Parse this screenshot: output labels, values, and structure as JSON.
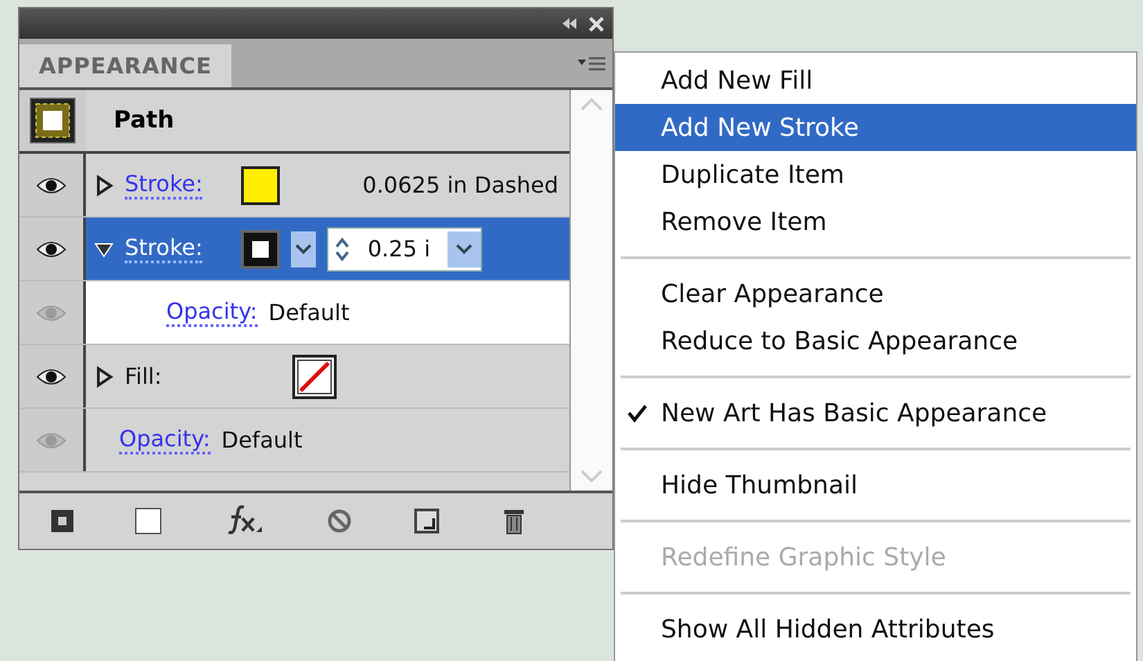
{
  "panel": {
    "tab": "APPEARANCE",
    "object": "Path",
    "rows": [
      {
        "kind": "stroke",
        "label": "Stroke:",
        "link": true,
        "expanded": false,
        "selected": false,
        "eye_dimmed": false,
        "color": "#ffee00",
        "value": "0.0625 in Dashed"
      },
      {
        "kind": "stroke",
        "label": "Stroke:",
        "link": true,
        "expanded": true,
        "selected": true,
        "eye_dimmed": false,
        "weight": "0.25 i",
        "children": [
          {
            "kind": "opacity",
            "label": "Opacity:",
            "link": true,
            "selected": false,
            "eye_dimmed": true,
            "value": "Default"
          }
        ]
      },
      {
        "kind": "fill",
        "label": "Fill:",
        "link": false,
        "expanded": false,
        "selected": false,
        "eye_dimmed": false
      },
      {
        "kind": "opacity",
        "label": "Opacity:",
        "link": true,
        "selected": false,
        "eye_dimmed": true,
        "value": "Default"
      }
    ]
  },
  "menu": {
    "groups": [
      [
        {
          "label": "Add New Fill",
          "selected": false,
          "checked": false,
          "disabled": false
        },
        {
          "label": "Add New Stroke",
          "selected": true,
          "checked": false,
          "disabled": false
        },
        {
          "label": "Duplicate Item",
          "selected": false,
          "checked": false,
          "disabled": false
        },
        {
          "label": "Remove Item",
          "selected": false,
          "checked": false,
          "disabled": false
        }
      ],
      [
        {
          "label": "Clear Appearance",
          "selected": false,
          "checked": false,
          "disabled": false
        },
        {
          "label": "Reduce to Basic Appearance",
          "selected": false,
          "checked": false,
          "disabled": false
        }
      ],
      [
        {
          "label": "New Art Has Basic Appearance",
          "selected": false,
          "checked": true,
          "disabled": false
        }
      ],
      [
        {
          "label": "Hide Thumbnail",
          "selected": false,
          "checked": false,
          "disabled": false
        }
      ],
      [
        {
          "label": "Redefine Graphic Style",
          "selected": false,
          "checked": false,
          "disabled": true
        }
      ],
      [
        {
          "label": "Show All Hidden Attributes",
          "selected": false,
          "checked": false,
          "disabled": false
        }
      ]
    ]
  }
}
